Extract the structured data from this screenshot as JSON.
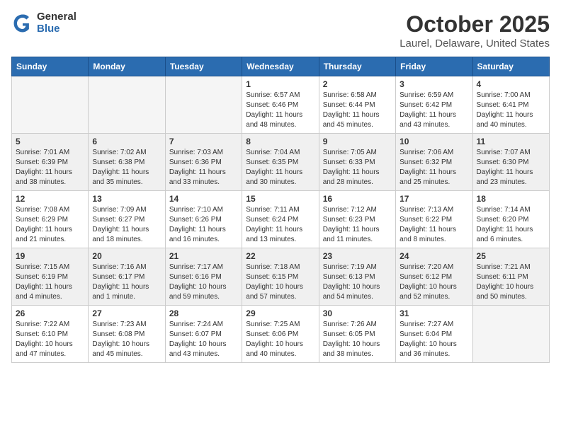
{
  "logo": {
    "general": "General",
    "blue": "Blue"
  },
  "header": {
    "month": "October 2025",
    "location": "Laurel, Delaware, United States"
  },
  "weekdays": [
    "Sunday",
    "Monday",
    "Tuesday",
    "Wednesday",
    "Thursday",
    "Friday",
    "Saturday"
  ],
  "weeks": [
    [
      {
        "day": "",
        "info": ""
      },
      {
        "day": "",
        "info": ""
      },
      {
        "day": "",
        "info": ""
      },
      {
        "day": "1",
        "info": "Sunrise: 6:57 AM\nSunset: 6:46 PM\nDaylight: 11 hours\nand 48 minutes."
      },
      {
        "day": "2",
        "info": "Sunrise: 6:58 AM\nSunset: 6:44 PM\nDaylight: 11 hours\nand 45 minutes."
      },
      {
        "day": "3",
        "info": "Sunrise: 6:59 AM\nSunset: 6:42 PM\nDaylight: 11 hours\nand 43 minutes."
      },
      {
        "day": "4",
        "info": "Sunrise: 7:00 AM\nSunset: 6:41 PM\nDaylight: 11 hours\nand 40 minutes."
      }
    ],
    [
      {
        "day": "5",
        "info": "Sunrise: 7:01 AM\nSunset: 6:39 PM\nDaylight: 11 hours\nand 38 minutes."
      },
      {
        "day": "6",
        "info": "Sunrise: 7:02 AM\nSunset: 6:38 PM\nDaylight: 11 hours\nand 35 minutes."
      },
      {
        "day": "7",
        "info": "Sunrise: 7:03 AM\nSunset: 6:36 PM\nDaylight: 11 hours\nand 33 minutes."
      },
      {
        "day": "8",
        "info": "Sunrise: 7:04 AM\nSunset: 6:35 PM\nDaylight: 11 hours\nand 30 minutes."
      },
      {
        "day": "9",
        "info": "Sunrise: 7:05 AM\nSunset: 6:33 PM\nDaylight: 11 hours\nand 28 minutes."
      },
      {
        "day": "10",
        "info": "Sunrise: 7:06 AM\nSunset: 6:32 PM\nDaylight: 11 hours\nand 25 minutes."
      },
      {
        "day": "11",
        "info": "Sunrise: 7:07 AM\nSunset: 6:30 PM\nDaylight: 11 hours\nand 23 minutes."
      }
    ],
    [
      {
        "day": "12",
        "info": "Sunrise: 7:08 AM\nSunset: 6:29 PM\nDaylight: 11 hours\nand 21 minutes."
      },
      {
        "day": "13",
        "info": "Sunrise: 7:09 AM\nSunset: 6:27 PM\nDaylight: 11 hours\nand 18 minutes."
      },
      {
        "day": "14",
        "info": "Sunrise: 7:10 AM\nSunset: 6:26 PM\nDaylight: 11 hours\nand 16 minutes."
      },
      {
        "day": "15",
        "info": "Sunrise: 7:11 AM\nSunset: 6:24 PM\nDaylight: 11 hours\nand 13 minutes."
      },
      {
        "day": "16",
        "info": "Sunrise: 7:12 AM\nSunset: 6:23 PM\nDaylight: 11 hours\nand 11 minutes."
      },
      {
        "day": "17",
        "info": "Sunrise: 7:13 AM\nSunset: 6:22 PM\nDaylight: 11 hours\nand 8 minutes."
      },
      {
        "day": "18",
        "info": "Sunrise: 7:14 AM\nSunset: 6:20 PM\nDaylight: 11 hours\nand 6 minutes."
      }
    ],
    [
      {
        "day": "19",
        "info": "Sunrise: 7:15 AM\nSunset: 6:19 PM\nDaylight: 11 hours\nand 4 minutes."
      },
      {
        "day": "20",
        "info": "Sunrise: 7:16 AM\nSunset: 6:17 PM\nDaylight: 11 hours\nand 1 minute."
      },
      {
        "day": "21",
        "info": "Sunrise: 7:17 AM\nSunset: 6:16 PM\nDaylight: 10 hours\nand 59 minutes."
      },
      {
        "day": "22",
        "info": "Sunrise: 7:18 AM\nSunset: 6:15 PM\nDaylight: 10 hours\nand 57 minutes."
      },
      {
        "day": "23",
        "info": "Sunrise: 7:19 AM\nSunset: 6:13 PM\nDaylight: 10 hours\nand 54 minutes."
      },
      {
        "day": "24",
        "info": "Sunrise: 7:20 AM\nSunset: 6:12 PM\nDaylight: 10 hours\nand 52 minutes."
      },
      {
        "day": "25",
        "info": "Sunrise: 7:21 AM\nSunset: 6:11 PM\nDaylight: 10 hours\nand 50 minutes."
      }
    ],
    [
      {
        "day": "26",
        "info": "Sunrise: 7:22 AM\nSunset: 6:10 PM\nDaylight: 10 hours\nand 47 minutes."
      },
      {
        "day": "27",
        "info": "Sunrise: 7:23 AM\nSunset: 6:08 PM\nDaylight: 10 hours\nand 45 minutes."
      },
      {
        "day": "28",
        "info": "Sunrise: 7:24 AM\nSunset: 6:07 PM\nDaylight: 10 hours\nand 43 minutes."
      },
      {
        "day": "29",
        "info": "Sunrise: 7:25 AM\nSunset: 6:06 PM\nDaylight: 10 hours\nand 40 minutes."
      },
      {
        "day": "30",
        "info": "Sunrise: 7:26 AM\nSunset: 6:05 PM\nDaylight: 10 hours\nand 38 minutes."
      },
      {
        "day": "31",
        "info": "Sunrise: 7:27 AM\nSunset: 6:04 PM\nDaylight: 10 hours\nand 36 minutes."
      },
      {
        "day": "",
        "info": ""
      }
    ]
  ]
}
